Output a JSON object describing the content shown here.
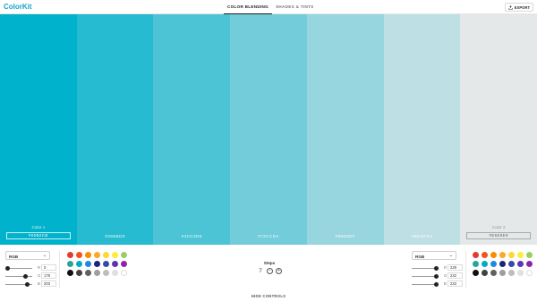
{
  "app": {
    "logo": "ColorKit"
  },
  "tabs": [
    {
      "label": "COLOR BLENDING",
      "active": true
    },
    {
      "label": "SHADES & TINTS",
      "active": false
    }
  ],
  "export_label": "EXPORT",
  "swatches": [
    {
      "hex": "#00B2CB",
      "color": "#00b2cb",
      "label": "Color 1",
      "editable": true
    },
    {
      "hex": "#26BBD0",
      "color": "#26bbd0",
      "label": "",
      "editable": false
    },
    {
      "hex": "#4CC4D5",
      "color": "#4cc4d5",
      "label": "",
      "editable": false
    },
    {
      "hex": "#72CCDA",
      "color": "#72ccda",
      "label": "",
      "editable": false
    },
    {
      "hex": "#98D6DF",
      "color": "#98d6df",
      "label": "",
      "editable": false
    },
    {
      "hex": "#BEDFE4",
      "color": "#bedfe4",
      "label": "",
      "editable": false
    },
    {
      "hex": "#E5E8E9",
      "color": "#e5e8e9",
      "label": "Color 2",
      "editable": true
    }
  ],
  "left_panel": {
    "mode": "RGB",
    "sliders": [
      {
        "label": "R",
        "value": "0",
        "fraction": 0.0
      },
      {
        "label": "G",
        "value": "178",
        "fraction": 0.7
      },
      {
        "label": "B",
        "value": "203",
        "fraction": 0.8
      }
    ]
  },
  "right_panel": {
    "mode": "RGB",
    "sliders": [
      {
        "label": "R",
        "value": "229",
        "fraction": 0.9
      },
      {
        "label": "G",
        "value": "232",
        "fraction": 0.91
      },
      {
        "label": "B",
        "value": "233",
        "fraction": 0.91
      }
    ]
  },
  "palette_colors": [
    "#e53935",
    "#f4511e",
    "#fb8c00",
    "#ffa726",
    "#fdd835",
    "#ffeb3b",
    "#9ccc65",
    "#26a69a",
    "#00acc1",
    "#1e88e5",
    "#1a237e",
    "#3949ab",
    "#5e35b1",
    "#8e24aa",
    "#111111",
    "#424242",
    "#616161",
    "#9e9e9e",
    "#bdbdbd",
    "#e0e0e0",
    "#ffffff"
  ],
  "steps": {
    "label": "Steps",
    "value": "7",
    "minus": "−",
    "plus": "+"
  },
  "hide_controls_label": "HIDE CONTROLS"
}
